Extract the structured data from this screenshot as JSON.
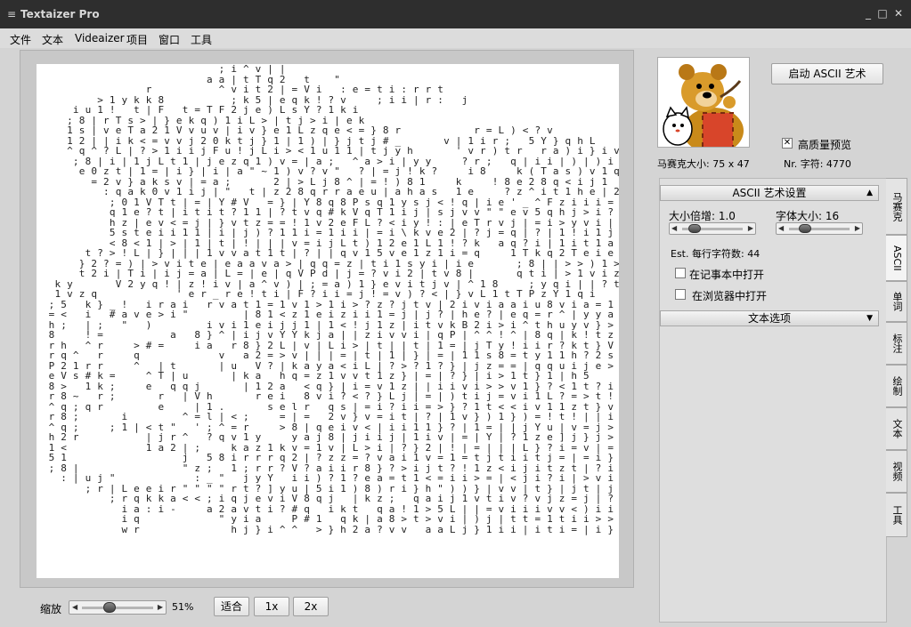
{
  "window": {
    "title": "Textaizer Pro",
    "controls": {
      "minimize": "_",
      "maximize": "□",
      "close": "✕"
    }
  },
  "menu": [
    "文件",
    "文本",
    "Videaizer",
    "项目",
    "窗口",
    "工具"
  ],
  "ascii_art_lines": [
    "                              ; i ^ v | |",
    "                            a a | t T q 2   t    \"",
    "                  r           ^ v i t 2 | = V i   : e = t i : r r t",
    "          > 1 y k k 8           ; k 5 | e q k ! ? v     ; i i | r :   j",
    "      i u 1 !   t | F   t = T F 2 j e ) L s Y ? 1 k i",
    "     ; 8 | r T s > | } e k q ) 1 i L > | t j > i | e k",
    "     1 s | v e T a 2 1 V v u v | i v } e 1 L z q e < = } 8 r            r = L ) < ? v",
    "     1 2 | | i k < = v v j 2 0 k t j } 1 | 1 ) | } j t j # _       v | 1 i r ;   5 Y } q h L",
    "     ^ q ^ ? L | ? > 1 i i j F u ! j L i > < 1 u 1 1 | t j y h       ' v r ) t r   r a ) i } i v q V",
    "      ; 8 | i | 1 j L t 1 | j e z q 1 ) v = | a ;   ^ a > i | y y     ? r ;   q | i i | ) | ) i v",
    "       e 0 z t | 1 = | i } | i | a \" ~ 1 ) v ? v \"   ? | = j ! k ?     i 8     k ( T a s ) v 1 q r",
    "         = 2 v } a k s v | = a ;       2 | > L j 8 ^ | = ! ) 8 1     k     ! 8 e 2 8 q < i j 1",
    "           : q a k 0 v 1 i j | \"   t | z 2 8 q r r a e u | a h a s   1 e     ? z ^ i t 1 h e | 2",
    "            ; 0 1 V T t | = | Y # V   = } | Y 8 q 8 P s q 1 y s j < ! q | i e ' _ ^ F z i i i = | h 5 | T",
    "            q 1 e ? t | i t i t ? 1 1 | ? t v q # k V q T 1 i j | s j v v \" \" e v 5 q h j > i ? 1 > d 1 q r",
    "            h z | e v < = j | } v t z = = ! 1 v 2 e F L ? < i y ! : | e T r v j | = i > y v i | = a Y e u >",
    "            5 s t e i i 1 1 | i | j ) ? 1 1 i = 1 i i | = i \\ k v e 2 | ? j = q | ? | 1 ! i 1 j i e v y F k",
    "            < 8 < 1 | > | 1 | t | ! | | | v = i j L t ) 1 2 e 1 L 1 ! ? k   a q ? i | 1 i t 1 a | e v q 2 r",
    "        t ? > ! L | } | | | 1 v v a t 1 t | ? | | q v 1 5 v e 1 z 1 i = q     1 T k q 2 T e i e i j v > 2 h y",
    "       } 2 ? = ) | > v i t e | e a a v a > | q q = z | t i 1 s y i | i e       ; 8 | | > > ) 1 > ) e < } > 5",
    "       t 2 i | T i | i j = a | L = | e | q V P d | j = ? v i 2 | t v 8 |       q t i | > 1 v i z = = k r 1 V i",
    "   k y       V 2 y q ! | z ! i v | a ^ v ) | ; = a ) 1 } e v i t j v | ^ 1 8     ; y q i | | ? t < z q z = v q q v",
    "   1 v z q             ' e r _ r e ! t i | F ? i i = j ! = v ) ? < | } v L 1 t T P z Y 1 q i     q | i ; a ) r h s 1 1 i = h 8 q",
    "  ; 5   k } _ !   i r a i   r v a t 1 = 1 v 1 > 1 i > ? z ? j t v | 2 i v i a a i u 8 v i a = 1 5 k 8 V a j 1 i 2 k z 1 \\ r 1 Y a q T",
    "  = <   i   # a v e > i \"         | 8 1 < z 1 e i z i i 1 = j | j ? | h e ? | e q = r ^ | y y a 1 L j v q h | ^ } a 8 | r 1 r i r 8 = = 0 ;",
    "  h ;   | ;   \"   )         i v i 1 e i j j 1 | 1 < ! j 1 z | i t v k B 2 i > i ^ t h u y v } > s h a k e ! 1 | t r r r 8 t 1 k r",
    "  8     ! =           a   8 } ^ | i j v Y Y k j a | | z i v v i | q P | ^ ^ ! ^ | 8 q | k ! t z i > i ! \\ ! 1 | i j y ? e Y j",
    "  r h   ^ r     > # =     i a   r 8 } 2 L | v | L i > | t | | t | 1 = | j T y ! i i r ? k t } V t ! ! | ! = ! | t Y ^ e 8 h",
    "  r q ^   r     q             v   a 2 = > v | | | = | t | 1 | } | = | 1 1 s 8 = t y 1 1 h ? 2 s T t > i r | ^ | e v r v } 8",
    "  P 2 1 r r     ^   | t       | u   V ? | k a y a < i L | ? > ? 1 ? } | j z = = | q q u i j e >   a t 1 e | | a a k i   ? i < y",
    "  e V s # k =     ^ T | u       | k a   h q = z 1 v v t 1 z } | = | ? } | i > 1 t } 1 | h 5     a e ) i k q a V V u < \" u 2 q t   k h",
    "  8 >   1 k ;     e   q q j       | 1 2 a   < q } | i = v 1 z | | i i v i > > v 1 } ? < 1 t ? i 2 k   k q j 1 8 r i 2 = \\ v s h 5 | 1 0 1",
    "  r 8 ~   r ;       r   | V h       r e i   8 v i ? < ? } L j | = | ) t i j = v i 1 L ? = > t ! k k q i j   | Y F a q 1 j r i d 5 q ^",
    "  ^ q ; q r         e     | 1 .       s e l r   q s | = i ? i i = > } ? 1 t < < i v 1 1 z t } v L ? | 1 Y } = k }     2 > 1 s 2 j k y 1 ;",
    "  r 8 ;       i         ^ = l | < ;     = | =   2 v } v = i t | ? | 1 v } ) 1 } ) = ! t ! | | i i ^ | y 2 1 s L | q y 2 a i",
    "  ^ q ;     ; 1 | < t \"   ' ; ^ = r     > 8 | q e i v < | i i 1 1 } ? | 1 = | | j Y u | v = j > ^ a e e q e 8 \\",
    "  h 2 r           | j r ^   ? q v 1 y     y a j 8 | j i i j | 1 i v | = | Y | ? 1 z e ] j } j > v ? 8 2 s ? ?",
    "  1 <             1 a 2 | ;     k a z 1 k v = 1 v | L > i | ? } 2 | ! | = | | | L } ? i = v | = ? u j 8",
    "  5 1                   j   5 8 i r r r q 2 | ? z z = ? v a i 1 v = 1 = t j t i i t j = | = i } h e q v",
    "  ; 8 |                 \" z ;   1 ; r r ? V ? a i i r 8 } ? > i j t ? ! 1 z < i j i t z t | ? i < 1 | ^ P e h q",
    "    : | u j \"             : _ \"   j y Y   i i ) ? 1 ? e a = t 1 < = i i > = | < j i ? i | > v i 1 t > j | i = | k s q r",
    "        ; r | L e e i r \" \" \" \" r t ? ] y u | 5 i 1 ) 8 ) r i } h \" ) ) } | v v | t } | j t | j | i | | | t i > j a 5 e h",
    "            ; r q k k a < < ; i q j e v i V 8 q j   | k z ;   q a i j 1 v t i v ? v j z = j | ? j v 1 1 < > = = v \\ 5 d F",
    "              i a : i -     a 2 a v t i ? # q   i k t   q a ! 1 > 5 L | | = v i i i v v < ) i i | i | t ! ! a q r",
    "              i q             \" y i a     P # 1   q k | a 8 > t > v i | ) j | t t = 1 t i i > > t 1 | = | L e q v",
    "              w r               h j } i ^ ^   > } h 2 a ? v v   a a L j } 1 i i | i t i = | i } t t | i ? | 1 1 1 T e"
  ],
  "zoom": {
    "label": "缩放",
    "value": "51%",
    "level": 0.51
  },
  "zoom_buttons": [
    "适合",
    "1x",
    "2x"
  ],
  "right_panel": {
    "launch_button": "启动 ASCII 艺术",
    "mosaic_size": "马赛克大小: 75 x 47",
    "char_count": "Nr. 字符: 4770",
    "hq_preview": {
      "label": "高质量预览",
      "checked": true
    }
  },
  "settings": {
    "section_title": "ASCII 艺术设置",
    "size_multiplier": {
      "label": "大小倍增: 1.0",
      "level": 0.15
    },
    "font_size": {
      "label": "字体大小: 16",
      "level": 0.22
    },
    "est_chars": "Est. 每行字符数: 44",
    "open_in_notepad": {
      "label": "在记事本中打开",
      "checked": false
    },
    "open_in_browser": {
      "label": "在浏览器中打开",
      "checked": false
    },
    "text_options": "文本选项"
  },
  "side_tabs": [
    "马赛克",
    "ASCII",
    "单词",
    "标注",
    "绘制",
    "文本",
    "视频",
    "工具"
  ],
  "colors": {
    "titlebar": "#2e2e2e",
    "panel": "#d4d4d4",
    "canvas": "#ffffff",
    "ascii_fg": "#222222"
  }
}
